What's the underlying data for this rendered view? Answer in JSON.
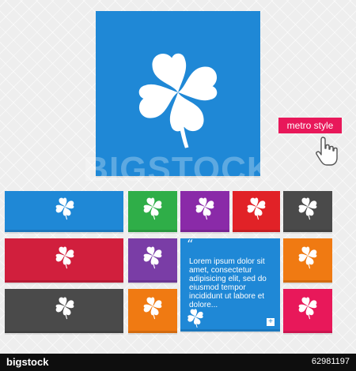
{
  "badge": {
    "label": "metro style"
  },
  "watermark": {
    "text": "BIGSTOCK"
  },
  "footer": {
    "brand": "bigstock",
    "stock_id": "62981197"
  },
  "text_tile": {
    "quote_mark": "“",
    "body": "Lorem ipsum dolor sit amet, consectetur adipisicing elit, sed do eiusmod tempor incididunt ut labore et dolore...",
    "plus": "+"
  },
  "icons": {
    "main": "four-leaf-clover-icon",
    "cursor": "hand-pointer-icon"
  },
  "colors": {
    "blue": "#1f88d6",
    "green": "#2fae48",
    "purple": "#8a2aa8",
    "red": "#e12227",
    "dark": "#4a4a4a",
    "crimson": "#d11f3d",
    "violet": "#7a3da6",
    "orange": "#f07a12",
    "pink": "#e8185a"
  }
}
